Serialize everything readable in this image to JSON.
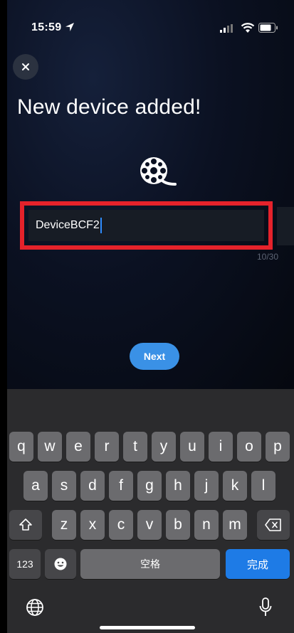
{
  "status_bar": {
    "time": "15:59"
  },
  "header": {
    "title": "New device added!"
  },
  "name_field": {
    "value": "DeviceBCF2",
    "counter": "10/30"
  },
  "next_button": {
    "label": "Next"
  },
  "keyboard": {
    "row1": [
      "q",
      "w",
      "e",
      "r",
      "t",
      "y",
      "u",
      "i",
      "o",
      "p"
    ],
    "row2": [
      "a",
      "s",
      "d",
      "f",
      "g",
      "h",
      "j",
      "k",
      "l"
    ],
    "row3": [
      "z",
      "x",
      "c",
      "v",
      "b",
      "n",
      "m"
    ],
    "numbers_label": "123",
    "space_label": "空格",
    "done_label": "完成"
  },
  "colors": {
    "accent": "#3a91e6",
    "highlight": "#e5222b",
    "done_key": "#1e7be6"
  }
}
